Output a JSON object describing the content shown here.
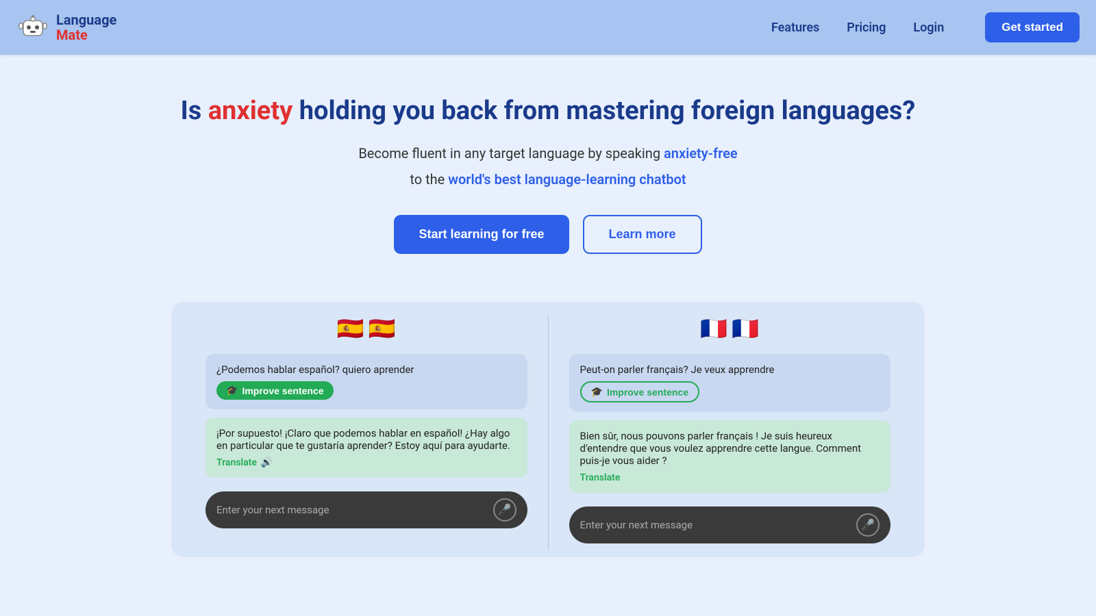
{
  "brand": {
    "name_line1": "Language",
    "name_line2": "Mate"
  },
  "nav": {
    "features": "Features",
    "pricing": "Pricing",
    "login": "Login",
    "get_started": "Get started"
  },
  "hero": {
    "title_pre": "Is ",
    "title_anxiety": "anxiety",
    "title_post": " holding you back from mastering foreign languages?",
    "subtitle_pre": "Become fluent in any target language by speaking ",
    "subtitle_anxiety_free": "anxiety-free",
    "subtitle_mid": " to the ",
    "subtitle_chatbot": "world's best language-learning chatbot"
  },
  "buttons": {
    "start_learning": "Start learning for free",
    "learn_more": "Learn more"
  },
  "demo": {
    "left": {
      "flag1": "🇪🇸",
      "flag2": "🇪🇸",
      "user_message": "¿Podemos hablar español? quiero aprender",
      "improve_label": "Improve sentence",
      "bot_message": "¡Por supuesto! ¡Claro que podemos hablar en español! ¿Hay algo en particular que te gustaría aprender? Estoy aquí para ayudarte.",
      "translate_label": "Translate",
      "input_placeholder": "Enter your next message"
    },
    "right": {
      "flag1": "🇫🇷",
      "flag2": "🇫🇷",
      "user_message": "Peut-on parler français? Je veux apprendre",
      "improve_label": "Improve sentence",
      "bot_message": "Bien sûr, nous pouvons parler français ! Je suis heureux d'entendre que vous voulez apprendre cette langue. Comment puis-je vous aider ?",
      "translate_label": "Translate",
      "input_placeholder": "Enter your next message"
    }
  },
  "icons": {
    "robot": "🤖",
    "mic": "🎤",
    "graduation": "🎓",
    "volume": "🔊"
  }
}
